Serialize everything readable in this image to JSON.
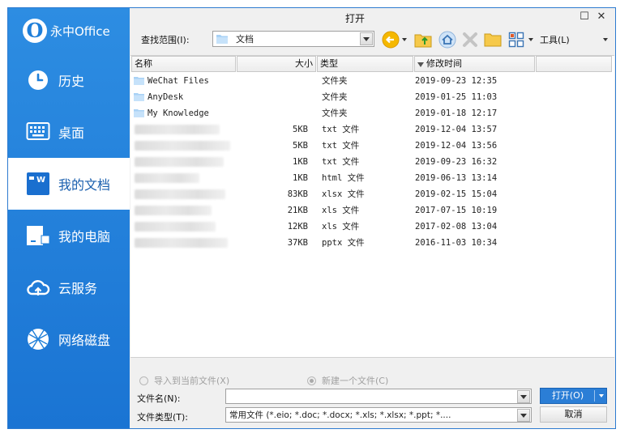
{
  "brand": {
    "logo_letter": "O",
    "name": "永中Office"
  },
  "nav": [
    {
      "label": "历史",
      "icon": "clock-icon"
    },
    {
      "label": "桌面",
      "icon": "desktop-icon"
    },
    {
      "label": "我的文档",
      "icon": "my-documents-icon",
      "active": true
    },
    {
      "label": "我的电脑",
      "icon": "computer-icon"
    },
    {
      "label": "云服务",
      "icon": "cloud-icon"
    },
    {
      "label": "网络磁盘",
      "icon": "network-disk-icon"
    }
  ],
  "dialog": {
    "title": "打开",
    "maximize": "☐",
    "close": "✕",
    "lookin_label": "查找范围(I):",
    "lookin_value": "文档",
    "tools_label": "工具(L)"
  },
  "columns": {
    "name": "名称",
    "size": "大小",
    "type": "类型",
    "modified": "修改时间"
  },
  "files": [
    {
      "name": "WeChat Files",
      "size": "",
      "type": "文件夹",
      "modified": "2019-09-23 12:35",
      "kind": "folder"
    },
    {
      "name": "AnyDesk",
      "size": "",
      "type": "文件夹",
      "modified": "2019-01-25 11:03",
      "kind": "folder"
    },
    {
      "name": "My Knowledge",
      "size": "",
      "type": "文件夹",
      "modified": "2019-01-18 12:17",
      "kind": "folder"
    },
    {
      "name": "",
      "size": "5KB",
      "type": "txt 文件",
      "modified": "2019-12-04 13:57",
      "kind": "blurred"
    },
    {
      "name": "",
      "size": "5KB",
      "type": "txt 文件",
      "modified": "2019-12-04 13:56",
      "kind": "blurred"
    },
    {
      "name": "",
      "size": "1KB",
      "type": "txt 文件",
      "modified": "2019-09-23 16:32",
      "kind": "blurred"
    },
    {
      "name": "",
      "size": "1KB",
      "type": "html 文件",
      "modified": "2019-06-13 13:14",
      "kind": "blurred"
    },
    {
      "name": "",
      "size": "83KB",
      "type": "xlsx 文件",
      "modified": "2019-02-15 15:04",
      "kind": "blurred"
    },
    {
      "name": "",
      "size": "21KB",
      "type": "xls 文件",
      "modified": "2017-07-15 10:19",
      "kind": "blurred"
    },
    {
      "name": "",
      "size": "12KB",
      "type": "xls 文件",
      "modified": "2017-02-08 13:04",
      "kind": "blurred"
    },
    {
      "name": "",
      "size": "37KB",
      "type": "pptx 文件",
      "modified": "2016-11-03 10:34",
      "kind": "blurred"
    }
  ],
  "options": {
    "import_label": "导入到当前文件(X)",
    "new_label": "新建一个文件(C)"
  },
  "fields": {
    "filename_label": "文件名(N):",
    "filename_value": "",
    "filetype_label": "文件类型(T):",
    "filetype_value": "常用文件 (*.eio; *.doc; *.docx; *.xls; *.xlsx; *.ppt; *...."
  },
  "buttons": {
    "open": "打开(O)",
    "cancel": "取消"
  },
  "colors": {
    "sidebar": "#1f7fd9",
    "accent": "#2b7ed6"
  }
}
